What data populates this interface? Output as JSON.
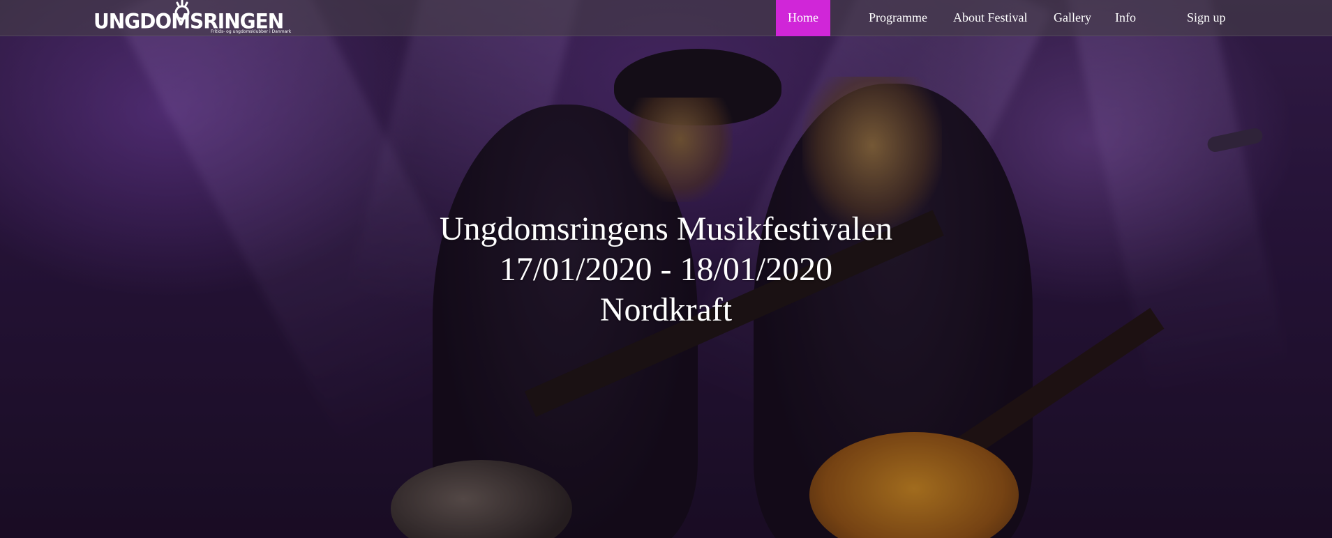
{
  "brand": {
    "logo_text": "UNGDOMSRINGEN",
    "tagline": "Fritids- og ungdomsklubber i Danmark"
  },
  "nav": {
    "active_color": "#d026d8",
    "items": [
      {
        "label": "Home",
        "active": true
      },
      {
        "label": "Programme",
        "active": false
      },
      {
        "label": "About Festival",
        "active": false
      },
      {
        "label": "Gallery",
        "active": false
      },
      {
        "label": "Info",
        "active": false
      },
      {
        "label": "Sign up",
        "active": false
      }
    ]
  },
  "hero": {
    "title": "Ungdomsringens Musikfestivalen",
    "dates": "17/01/2020 - 18/01/2020",
    "venue": "Nordkraft",
    "background": "concert photo of two guitarists on purple-lit stage"
  }
}
